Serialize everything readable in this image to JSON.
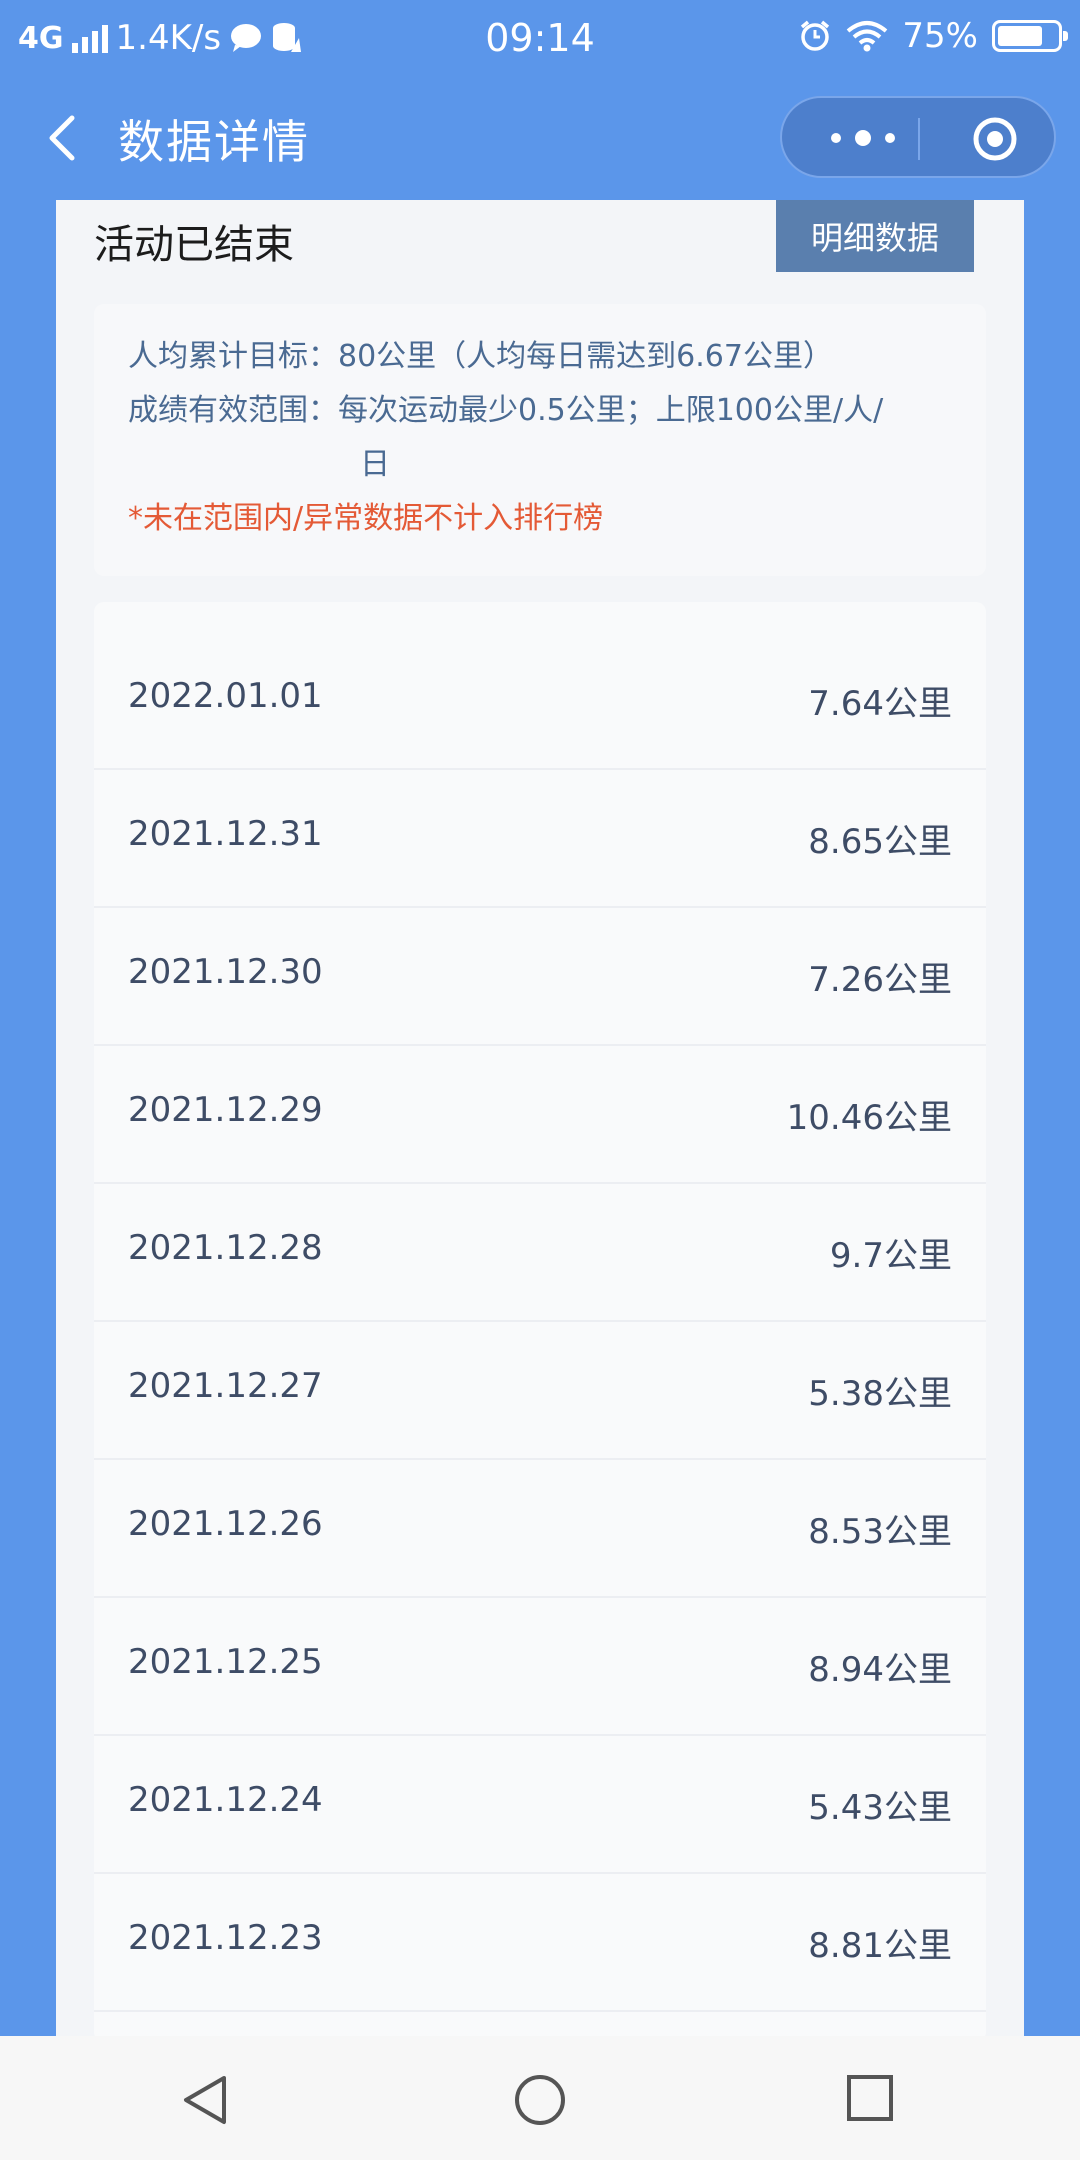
{
  "status_bar": {
    "network": "4G",
    "speed": "1.4K/s",
    "time": "09:14",
    "battery": "75%",
    "battery_level": 0.75
  },
  "nav": {
    "title": "数据详情"
  },
  "header": {
    "status": "活动已结束",
    "detail_button": "明细数据"
  },
  "info": {
    "target": "人均累计目标：80公里（人均每日需达到6.67公里）",
    "range_line1": "成绩有效范围：每次运动最少0.5公里；上限100公里/人/",
    "range_line2": "日",
    "note": "*未在范围内/异常数据不计入排行榜"
  },
  "records": [
    {
      "date": "2022.01.01",
      "distance": "7.64公里"
    },
    {
      "date": "2021.12.31",
      "distance": "8.65公里"
    },
    {
      "date": "2021.12.30",
      "distance": "7.26公里"
    },
    {
      "date": "2021.12.29",
      "distance": "10.46公里"
    },
    {
      "date": "2021.12.28",
      "distance": "9.7公里"
    },
    {
      "date": "2021.12.27",
      "distance": "5.38公里"
    },
    {
      "date": "2021.12.26",
      "distance": "8.53公里"
    },
    {
      "date": "2021.12.25",
      "distance": "8.94公里"
    },
    {
      "date": "2021.12.24",
      "distance": "5.43公里"
    },
    {
      "date": "2021.12.23",
      "distance": "8.81公里"
    }
  ],
  "colors": {
    "brand": "#5b96ea",
    "button": "#5a7fae",
    "warning": "#e45a36"
  }
}
